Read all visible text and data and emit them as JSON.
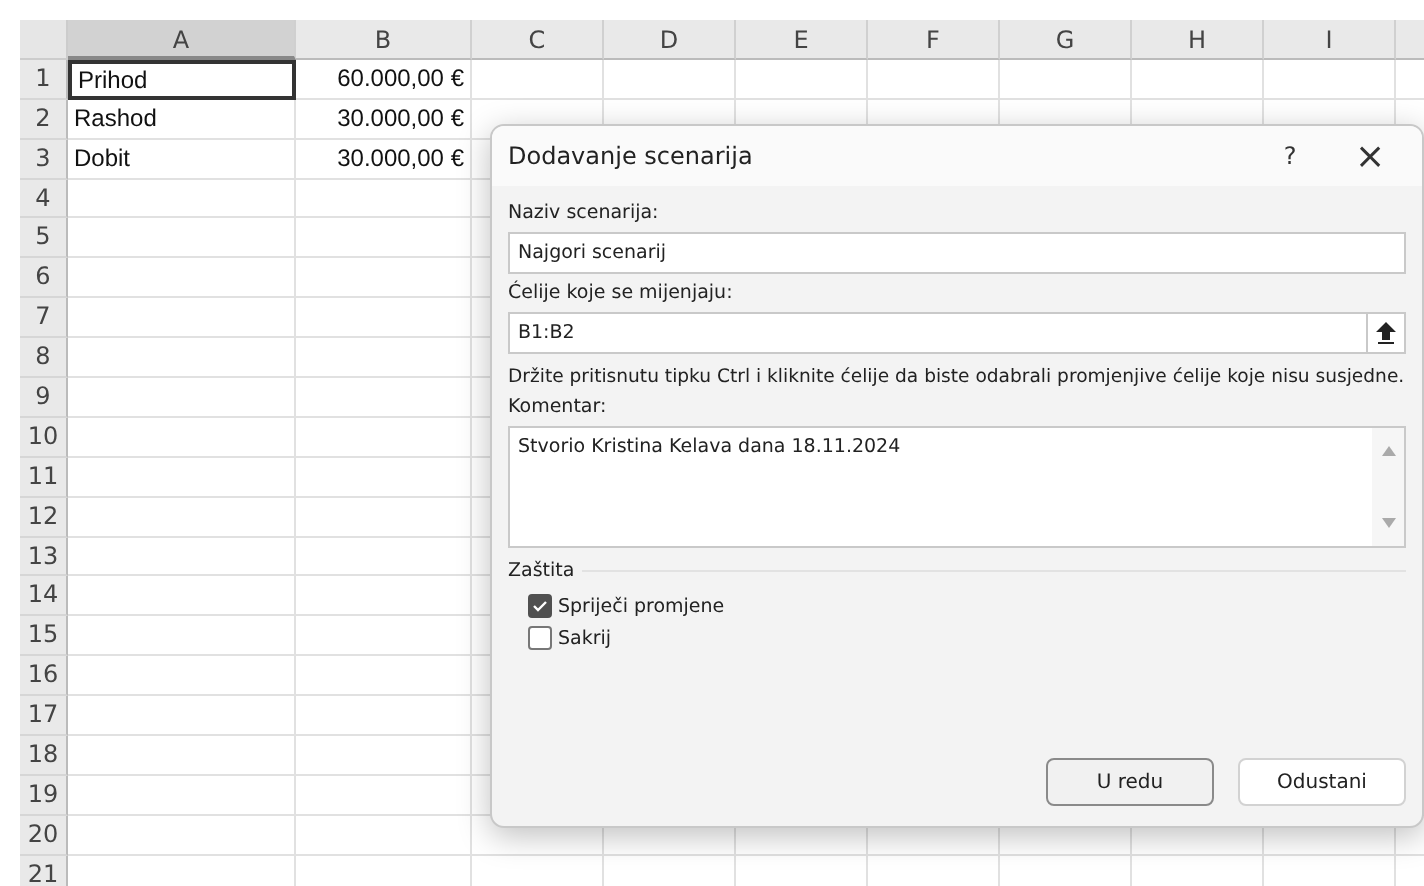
{
  "sheet": {
    "columns": [
      {
        "label": "A",
        "selected": true
      },
      {
        "label": "B",
        "selected": false
      },
      {
        "label": "C",
        "selected": false
      },
      {
        "label": "D",
        "selected": false
      },
      {
        "label": "E",
        "selected": false
      },
      {
        "label": "F",
        "selected": false
      },
      {
        "label": "G",
        "selected": false
      },
      {
        "label": "H",
        "selected": false
      },
      {
        "label": "I",
        "selected": false
      }
    ],
    "rows": [
      {
        "header": "1",
        "cells": [
          {
            "text": "Prihod",
            "selected": true
          },
          {
            "text": "60.000,00 €",
            "selected": false
          }
        ]
      },
      {
        "header": "2",
        "cells": [
          {
            "text": "Rashod",
            "selected": false
          },
          {
            "text": "30.000,00 €",
            "selected": false
          }
        ]
      },
      {
        "header": "3",
        "cells": [
          {
            "text": "Dobit",
            "selected": false
          },
          {
            "text": "30.000,00 €",
            "selected": false
          }
        ]
      },
      {
        "header": "4"
      },
      {
        "header": "5"
      },
      {
        "header": "6"
      },
      {
        "header": "7"
      },
      {
        "header": "8"
      },
      {
        "header": "9"
      },
      {
        "header": "10"
      },
      {
        "header": "11"
      },
      {
        "header": "12"
      },
      {
        "header": "13"
      },
      {
        "header": "14"
      },
      {
        "header": "15"
      },
      {
        "header": "16"
      },
      {
        "header": "17"
      },
      {
        "header": "18"
      },
      {
        "header": "19"
      },
      {
        "header": "20"
      },
      {
        "header": "21"
      }
    ]
  },
  "dialog": {
    "title": "Dodavanje scenarija",
    "help": "?",
    "close": "×",
    "name_label": "Naziv scenarija:",
    "name_value": "Najgori scenarij",
    "cells_label": "Ćelije koje se mijenjaju:",
    "cells_value": "B1:B2",
    "hint": "Držite pritisnutu tipku Ctrl i kliknite ćelije da biste odabrali promjenjive ćelije koje nisu susjedne.",
    "comment_label": "Komentar:",
    "comment_value": "Stvorio Kristina Kelava dana 18.11.2024",
    "protection_label": "Zaštita",
    "options": [
      {
        "label": "Spriječi promjene",
        "checked": true
      },
      {
        "label": "Sakrij",
        "checked": false
      }
    ],
    "buttons": [
      {
        "label": "U redu",
        "default": true
      },
      {
        "label": "Odustani",
        "default": false
      }
    ]
  }
}
